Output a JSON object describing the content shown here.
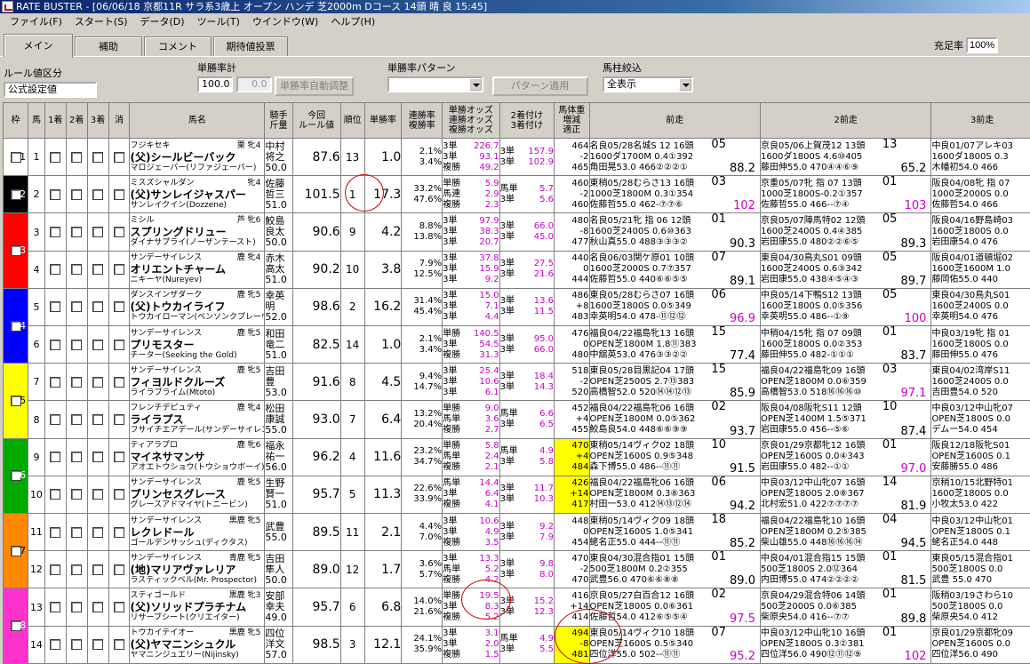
{
  "window": {
    "title": "RATE BUSTER - [06/06/18 京都11R サラ系3歳上 オープン ハンデ 芝2000m Dコース 14頭 晴 良 15:45]"
  },
  "menu": [
    "ファイル(F)",
    "スタート(S)",
    "データ(D)",
    "ツール(T)",
    "ウインドウ(W)",
    "ヘルプ(H)"
  ],
  "tabs": [
    "メイン",
    "補助",
    "コメント",
    "期待値投票"
  ],
  "fill_rate": {
    "label": "充足率",
    "value": "100%"
  },
  "rule": {
    "label": "ルール値区分",
    "value": "公式設定値"
  },
  "tansho": {
    "label": "単勝率計",
    "value": "100.0",
    "value2": "0.0",
    "button": "単勝率自動調整"
  },
  "pattern": {
    "label": "単勝率パターン",
    "button": "パターン適用"
  },
  "filter": {
    "label": "馬柱絞込",
    "value": "全表示"
  },
  "headers": {
    "waku": "枠",
    "uma": "馬",
    "first": "1着",
    "second": "2着",
    "third": "3着",
    "erase": "消",
    "name": "馬名",
    "jockey": [
      "騎手",
      "斤量"
    ],
    "rule": [
      "今回",
      "ルール値"
    ],
    "rank": "順位",
    "win": "単勝率",
    "rate": [
      "連勝率",
      "複勝率"
    ],
    "odds": [
      "単勝オッズ",
      "連勝オッズ",
      "複勝オッズ"
    ],
    "tuke": [
      "2着付け",
      "3着付け"
    ],
    "weight": [
      "馬体重",
      "増減",
      "適正"
    ],
    "prev1": "前走",
    "prev2": "2前走",
    "prev3": "3前走"
  },
  "waku_colors": [
    "#ffffff",
    "#000000",
    "#ff0000",
    "#0000ff",
    "#ffff00",
    "#00aa00",
    "#ff8800",
    "#ff33cc"
  ],
  "horses": [
    {
      "waku": 1,
      "num": "1",
      "sire": "フジキセキ",
      "sex": "栗 牝4",
      "name": "(父)シールビーバック",
      "dam": "マロジェーバー(リファジェーバー)",
      "jockey": [
        "中村",
        "将之",
        "50.0"
      ],
      "rule": "87.6",
      "rank": "13",
      "win": "1.0",
      "rate": [
        "2.1%",
        "3.4%"
      ],
      "odds": [
        [
          "3単",
          "226.7"
        ],
        [
          "3単",
          "93.1"
        ],
        [
          "複勝",
          "49.2"
        ]
      ],
      "tuke": [
        [
          "",
          ""
        ],
        [
          "3単",
          "157.9"
        ],
        [
          "3単",
          "102.9"
        ]
      ],
      "weight": [
        "464",
        "-2",
        "465"
      ],
      "p1": [
        "名良05/28名城S 12 16頭",
        "1600ダ1700M 0.4①392",
        "角田晃53.0 466②②②①"
      ],
      "p1sc": "88.2",
      "p1pl": "05",
      "p2": [
        "京良05/06上賀茂12 13頭",
        "1600ダ1800S 4.6⑩405",
        "藤田伸55.0 470④④⑥⑨"
      ],
      "p2sc": "65.2",
      "p2pl": "13",
      "p3": [
        "中良01/07アレキ03",
        "1600ダ1800S 0.3",
        "木幡初54.0 466"
      ]
    },
    {
      "waku": 2,
      "num": "2",
      "sire": "ミスズシャルダン",
      "sex": "牝4",
      "name": "(父)サンレイジャスパー",
      "dam": "サンレイクイン(Dozzene)",
      "jockey": [
        "佐藤",
        "哲三",
        "51.0"
      ],
      "rule": "101.5",
      "rank": "1",
      "win": "17.3",
      "rate": [
        "33.2%",
        "47.6%"
      ],
      "odds": [
        [
          "単勝",
          "5.9"
        ],
        [
          "馬連",
          "2.9"
        ],
        [
          "複勝",
          "2.3"
        ]
      ],
      "tuke": [
        [
          "",
          ""
        ],
        [
          "馬単",
          "5.7"
        ],
        [
          "3単",
          "5.6"
        ]
      ],
      "weight": [
        "460",
        "-2",
        "460"
      ],
      "p1": [
        "東稍05/28むらさ13 16頭",
        "1000芝1800M 0.3①354",
        "佐藤哲55.0 462-⑦⑦⑥"
      ],
      "p1sc": "102",
      "p1pl": "03",
      "p2": [
        "京重05/07牝 指 07 13頭",
        "1000芝1800S-0.2①357",
        "佐藤哲55.0 466--⑦④"
      ],
      "p2sc": "103",
      "p2pl": "01",
      "p3": [
        "阪良04/08牝 指 07",
        "1000芝2000S 0.0",
        "佐藤哲54.0 466"
      ]
    },
    {
      "waku": 3,
      "num": "3",
      "sire": "ミシル",
      "sex": "芦 牝6",
      "name": "スプリングドリュー",
      "dam": "ダイナサプライ(ノーザンテースト)",
      "jockey": [
        "鮫島",
        "良太",
        "50.0"
      ],
      "rule": "90.6",
      "rank": "9",
      "win": "4.2",
      "rate": [
        "8.8%",
        "13.8%"
      ],
      "odds": [
        [
          "3単",
          "97.9"
        ],
        [
          "3単",
          "38.3"
        ],
        [
          "3単",
          "20.7"
        ]
      ],
      "tuke": [
        [
          "",
          ""
        ],
        [
          "3単",
          "66.0"
        ],
        [
          "3単",
          "45.0"
        ]
      ],
      "weight": [
        "480",
        "-8",
        "477"
      ],
      "p1": [
        "名良05/21牝 指 06 12頭",
        "1600芝2400S 0.6⑩363",
        "秋山真55.0 488③③③②"
      ],
      "p1sc": "90.3",
      "p1pl": "01",
      "p2": [
        "京良05/07陣馬特02 12頭",
        "1600芝2400S 0.4④385",
        "岩田康55.0 480②②⑥⑤"
      ],
      "p2sc": "89.3",
      "p2pl": "05",
      "p3": [
        "阪良04/16野島崎03",
        "1600芝1800S 0.0",
        "岩田康54.0 476"
      ]
    },
    {
      "waku": 3,
      "num": "4",
      "sire": "サンデーサイレンス",
      "sex": "鹿 牝4",
      "name": "オリエントチャーム",
      "dam": "ニキーヤ(Nureyev)",
      "jockey": [
        "赤木",
        "高太",
        "51.0"
      ],
      "rule": "90.2",
      "rank": "10",
      "win": "3.8",
      "rate": [
        "7.9%",
        "12.5%"
      ],
      "odds": [
        [
          "3単",
          "37.8"
        ],
        [
          "3単",
          "15.9"
        ],
        [
          "3単",
          "9.2"
        ]
      ],
      "tuke": [
        [
          "",
          ""
        ],
        [
          "3単",
          "27.5"
        ],
        [
          "3単",
          "21.6"
        ]
      ],
      "weight": [
        "440",
        "0",
        "444"
      ],
      "p1": [
        "名良06/03関ケ原01 10頭",
        "1600芝2000S 0.7⑦357",
        "佐藤哲55.0 440⑥⑥⑤⑤"
      ],
      "p1sc": "89.1",
      "p1pl": "07",
      "p2": [
        "東良04/30鳥丸S01 09頭",
        "1600芝2400S 0.6③342",
        "岩田康55.0 438④⑤④③"
      ],
      "p2sc": "89.7",
      "p2pl": "05",
      "p3": [
        "阪良04/01道頓堀02",
        "1600芝1600M 1.0",
        "藤岡佑55.0 440"
      ]
    },
    {
      "waku": 4,
      "num": "5",
      "sire": "ダンスインザダーク",
      "sex": "鹿 牝5",
      "name": "(父)トウカイライフ",
      "dam": "トウカイローマン(ベンソンクプレーヴ)",
      "jockey": [
        "幸英",
        "明",
        "52.0"
      ],
      "rule": "98.6",
      "rank": "2",
      "win": "16.2",
      "rate": [
        "31.4%",
        "45.4%"
      ],
      "odds": [
        [
          "3単",
          "15.0"
        ],
        [
          "3単",
          "7.1"
        ],
        [
          "3単",
          "4.4"
        ]
      ],
      "tuke": [
        [
          "",
          ""
        ],
        [
          "3単",
          "13.6"
        ],
        [
          "3単",
          "11.5"
        ]
      ],
      "weight": [
        "486",
        "+8",
        "483"
      ],
      "p1": [
        "東良05/28むらさ07 16頭",
        "1600芝1800S 0.0⑤349",
        "幸英明54.0 478-⑪⑫⑫"
      ],
      "p1sc": "96.9",
      "p1pl": "06",
      "p2": [
        "中良05/14下鴨S12 13頭",
        "1600芝1800S 0.0⑤356",
        "幸英明55.0 486--①⑨"
      ],
      "p2sc": "100",
      "p2pl": "05",
      "p3": [
        "東良04/30鳥丸S01",
        "1600芝2400S 0.0",
        "幸英明54.0 476"
      ]
    },
    {
      "waku": 4,
      "num": "6",
      "sire": "サンデーサイレンス",
      "sex": "鹿 牝5",
      "name": "プリモスター",
      "dam": "チーター(Seeking the Gold)",
      "jockey": [
        "和田",
        "竜二",
        "51.0"
      ],
      "rule": "82.5",
      "rank": "14",
      "win": "1.0",
      "rate": [
        "2.1%",
        "3.4%"
      ],
      "odds": [
        [
          "単勝",
          "140.5"
        ],
        [
          "3単",
          "54.5"
        ],
        [
          "複勝",
          "31.3"
        ]
      ],
      "tuke": [
        [
          "",
          ""
        ],
        [
          "3単",
          "95.0"
        ],
        [
          "3単",
          "66.0"
        ]
      ],
      "weight": [
        "476",
        "0",
        "480"
      ],
      "p1": [
        "福良04/22福島牝13 16頭",
        "OPEN芝1800M 1.8⑪383",
        "中舘英53.0 476③③②②"
      ],
      "p1sc": "77.4",
      "p1pl": "15",
      "p2": [
        "中稍04/15牝 指 07 09頭",
        "1600芝1800S 0.0②353",
        "藤田伸55.0 482-①①①"
      ],
      "p2sc": "83.7",
      "p2pl": "01",
      "p3": [
        "中良03/19牝 指 01",
        "1600芝1800S 0.0",
        "藤田伸55.0 476"
      ]
    },
    {
      "waku": 5,
      "num": "7",
      "sire": "サンデーサイレンス",
      "sex": "鹿 牝5",
      "name": "フィヨルドクルーズ",
      "dam": "ライラプライム(Mtoto)",
      "jockey": [
        "吉田",
        "豊",
        "53.0"
      ],
      "rule": "91.6",
      "rank": "8",
      "win": "4.5",
      "rate": [
        "9.4%",
        "14.7%"
      ],
      "odds": [
        [
          "3単",
          "25.4"
        ],
        [
          "3単",
          "10.6"
        ],
        [
          "3単",
          "6.1"
        ]
      ],
      "tuke": [
        [
          "",
          ""
        ],
        [
          "3単",
          "18.4"
        ],
        [
          "3単",
          "14.3"
        ]
      ],
      "weight": [
        "518",
        "-2",
        "520"
      ],
      "p1": [
        "東良05/28目黒記04 17頭",
        "OPEN芝2500S 2.7⑬383",
        "高橋智52.0 520⑭⑭⑫⑬"
      ],
      "p1sc": "85.9",
      "p1pl": "15",
      "p2": [
        "福良04/22福島牝09 16頭",
        "OPEN芝1800M 0.0⑥359",
        "高橋智53.0 518⑯⑯⑯⑩"
      ],
      "p2sc": "97.1",
      "p2pl": "03",
      "p3": [
        "東良04/02湾岸S11",
        "1600芝2400S 0.0",
        "吉田豊54.0 520"
      ]
    },
    {
      "waku": 5,
      "num": "8",
      "sire": "フレンチデピュティ",
      "sex": "鹿 牝4",
      "name": "ライラプス",
      "dam": "フサイチエアデール(サンデーサイレンス)",
      "jockey": [
        "松田",
        "康誠",
        "55.0"
      ],
      "rule": "93.0",
      "rank": "7",
      "win": "6.4",
      "rate": [
        "13.2%",
        "20.4%"
      ],
      "odds": [
        [
          "単勝",
          "9.0"
        ],
        [
          "馬単",
          "3.6"
        ],
        [
          "複勝",
          "2.7"
        ]
      ],
      "tuke": [
        [
          "",
          ""
        ],
        [
          "馬単",
          "6.6"
        ],
        [
          "3単",
          "6.5"
        ]
      ],
      "weight": [
        "452",
        "+4",
        "455"
      ],
      "p1": [
        "福良04/22福島牝06 16頭",
        "OPEN芝1800M 0.0⑤362",
        "鮫島良54.0 448⑥⑥⑨⑨"
      ],
      "p1sc": "93.7",
      "p1pl": "02",
      "p2": [
        "阪良04/08阪牝S11 12頭",
        "OPEN芝1400M 1.5⑤371",
        "岩田康55.0 456--⑤⑥"
      ],
      "p2sc": "87.4",
      "p2pl": "10",
      "p3": [
        "中良03/12中山牝07",
        "OPEN芝1800S 0.0",
        "デムー54.0 454"
      ]
    },
    {
      "waku": 6,
      "num": "9",
      "sire": "ティアラプロ",
      "sex": "鹿 牝6",
      "name": "マイネサマンサ",
      "dam": "アオエトウショウ(トウショウボーイ)",
      "jockey": [
        "福永",
        "祐一",
        "56.0"
      ],
      "rule": "96.2",
      "rank": "4",
      "win": "11.6",
      "rate": [
        "23.2%",
        "34.7%"
      ],
      "odds": [
        [
          "単勝",
          "5.8"
        ],
        [
          "馬単",
          "2.4"
        ],
        [
          "複勝",
          "2.1"
        ]
      ],
      "tuke": [
        [
          "",
          ""
        ],
        [
          "馬単",
          "4.9"
        ],
        [
          "3単",
          "5.8"
        ]
      ],
      "weight": [
        "470",
        "+4",
        "484"
      ],
      "p1": [
        "東稍05/14ヴィク02 18頭",
        "OPEN芝1600S 0.9⑤348",
        "森下博55.0 486--⑪⑪"
      ],
      "p1sc": "91.5",
      "p1pl": "10",
      "p2": [
        "京良01/29京都牝12 16頭",
        "OPEN芝1600S 0.0④343",
        "岩田康55.0 482--①①"
      ],
      "p2sc": "97.0",
      "p2pl": "01",
      "p3": [
        "阪良12/18阪牝S01",
        "OPEN芝1600S 0.1",
        "安藤勝55.0 486"
      ]
    },
    {
      "waku": 6,
      "num": "10",
      "sire": "サンデーサイレンス",
      "sex": "鹿 牝5",
      "name": "プリンセスグレース",
      "dam": "グレースアドマイヤ(トニービン)",
      "jockey": [
        "生野",
        "賢一",
        "51.0"
      ],
      "rule": "95.7",
      "rank": "5",
      "win": "11.3",
      "rate": [
        "22.6%",
        "33.9%"
      ],
      "odds": [
        [
          "馬単",
          "14.4"
        ],
        [
          "3単",
          "6.4"
        ],
        [
          "複勝",
          "4.1"
        ]
      ],
      "tuke": [
        [
          "",
          ""
        ],
        [
          "3単",
          "11.7"
        ],
        [
          "3単",
          "10.3"
        ]
      ],
      "weight": [
        "426",
        "+14",
        "417"
      ],
      "p1": [
        "福良04/22福島牝06 16頭",
        "OPEN芝1800M 0.3⑧363",
        "村田一53.0 412⑭⑬⑫⑭"
      ],
      "p1sc": "94.2",
      "p1pl": "06",
      "p2": [
        "中良03/12中山牝07 16頭",
        "OPEN芝1800S 2.0⑧367",
        "北村宏51.0 422⑦⑦⑦⑦"
      ],
      "p2sc": "81.9",
      "p2pl": "14",
      "p3": [
        "京稍10/15北野特01",
        "1600芝1800S 0.0",
        "小牧太53.0 422"
      ]
    },
    {
      "waku": 7,
      "num": "11",
      "sire": "サンデーサイレンス",
      "sex": "黒鹿 牝5",
      "name": "レクレドール",
      "dam": "ゴールデンサッシュ(ディクタス)",
      "jockey": [
        "武豊",
        "",
        "55.0"
      ],
      "rule": "89.5",
      "rank": "11",
      "win": "2.1",
      "rate": [
        "4.4%",
        "7.0%"
      ],
      "odds": [
        [
          "3単",
          "10.6"
        ],
        [
          "3単",
          "4.9"
        ],
        [
          "複勝",
          "3.5"
        ]
      ],
      "tuke": [
        [
          "",
          ""
        ],
        [
          "3単",
          "9.2"
        ],
        [
          "3単",
          "7.9"
        ]
      ],
      "weight": [
        "448",
        "0",
        "454"
      ],
      "p1": [
        "東稍05/14ヴィク09 18頭",
        "OPEN芝1600S 1.0⑤341",
        "蛯名正55.0 444--⑪⑪"
      ],
      "p1sc": "85.2",
      "p1pl": "18",
      "p2": [
        "福良04/22福島牝10 16頭",
        "OPEN芝1800M 0.2⑤385",
        "柴山雄55.0 448⑯⑯⑯⑭"
      ],
      "p2sc": "94.5",
      "p2pl": "04",
      "p3": [
        "中良03/12中山牝01",
        "OPEN芝1800S 0.1",
        "蛯名正54.0 448"
      ]
    },
    {
      "waku": 7,
      "num": "12",
      "sire": "サンデーサイレンス",
      "sex": "青鹿 牝5",
      "name": "(地)マリアヴァレリア",
      "dam": "ラスティックベル(Mr. Prospector)",
      "jockey": [
        "吉田",
        "隼人",
        "50.0"
      ],
      "rule": "89.0",
      "rank": "12",
      "win": "1.7",
      "rate": [
        "3.6%",
        "5.7%"
      ],
      "odds": [
        [
          "3単",
          "13.3"
        ],
        [
          "馬単",
          "5.2"
        ],
        [
          "複勝",
          "4.2"
        ]
      ],
      "tuke": [
        [
          "",
          ""
        ],
        [
          "3単",
          "9.8"
        ],
        [
          "3単",
          "8.0"
        ]
      ],
      "weight": [
        "470",
        "-2",
        "470"
      ],
      "p1": [
        "東良04/30混合指01 15頭",
        "500芝1800M 0.2②355",
        "武豊56.0 470⑥⑥⑧⑧"
      ],
      "p1sc": "89.0",
      "p1pl": "01",
      "p2": [
        "中良04/01混合指15 15頭",
        "500芝1800S 2.0⑫364",
        "内田博55.0 474②②②②"
      ],
      "p2sc": "81.5",
      "p2pl": "01",
      "p3": [
        "東良05/15混合指01",
        "500芝1800S 0.0",
        "武豊 55.0 470"
      ]
    },
    {
      "waku": 8,
      "num": "13",
      "sire": "スティゴールド",
      "sex": "黒鹿 牝3",
      "name": "(父)ソリッドプラチナム",
      "dam": "リサーブシート(クリエイター)",
      "jockey": [
        "安部",
        "幸夫",
        "49.0"
      ],
      "rule": "95.7",
      "rank": "6",
      "win": "6.8",
      "rate": [
        "14.0%",
        "21.6%"
      ],
      "odds": [
        [
          "単勝",
          "19.5"
        ],
        [
          "3単",
          "8.3"
        ],
        [
          "複勝",
          "5.2"
        ]
      ],
      "tuke": [
        [
          "",
          ""
        ],
        [
          "3単",
          "15.2"
        ],
        [
          "3単",
          "12.3"
        ]
      ],
      "weight": [
        "416",
        "+14",
        "414"
      ],
      "p1": [
        "京良05/27白百合12 16頭",
        "OPEN芝1800S 0.0⑥361",
        "佐藤哲54.0 412⑥⑤⑤④"
      ],
      "p1sc": "97.5",
      "p1pl": "02",
      "p2": [
        "京良04/29混合特06 14頭",
        "500芝2000S 0.0⑥385",
        "柴原央54.0 416--⑦⑦"
      ],
      "p2sc": "89.8",
      "p2pl": "01",
      "p3": [
        "阪稍03/19さわら10",
        "500芝1800S 0.0",
        "柴原央54.0 412"
      ]
    },
    {
      "waku": 8,
      "num": "14",
      "sire": "トウカイテイオー",
      "sex": "黒鹿 牝5",
      "name": "(父)ヤマニンシュクル",
      "dam": "ヤマニンジュエリー(Nijinsky)",
      "jockey": [
        "四位",
        "洋文",
        "57.0"
      ],
      "rule": "98.5",
      "rank": "3",
      "win": "12.1",
      "rate": [
        "24.1%",
        "35.9%"
      ],
      "odds": [
        [
          "3単",
          "3.1"
        ],
        [
          "3単",
          "2.0"
        ],
        [
          "複勝",
          "1.5"
        ]
      ],
      "tuke": [
        [
          "",
          ""
        ],
        [
          "馬単",
          "4.9"
        ],
        [
          "3単",
          "5.5"
        ]
      ],
      "weight": [
        "494",
        "-8",
        "481"
      ],
      "p1": [
        "東良05/14ヴィク10 18頭",
        "OPEN芝1600S 0.5⑤340",
        "四位洋55.0 502--⑪⑪"
      ],
      "p1sc": "95.2",
      "p1pl": "07",
      "p2": [
        "中良03/12中山牝10 16頭",
        "OPEN芝1800S 0.3②381",
        "四位洋56.0 490⑫⑪⑫⑨"
      ],
      "p2sc": "102",
      "p2pl": "01",
      "p3": [
        "京良01/29京都牝09",
        "OPEN芝1600S 0.0",
        "四位洋56.0 490"
      ]
    }
  ]
}
